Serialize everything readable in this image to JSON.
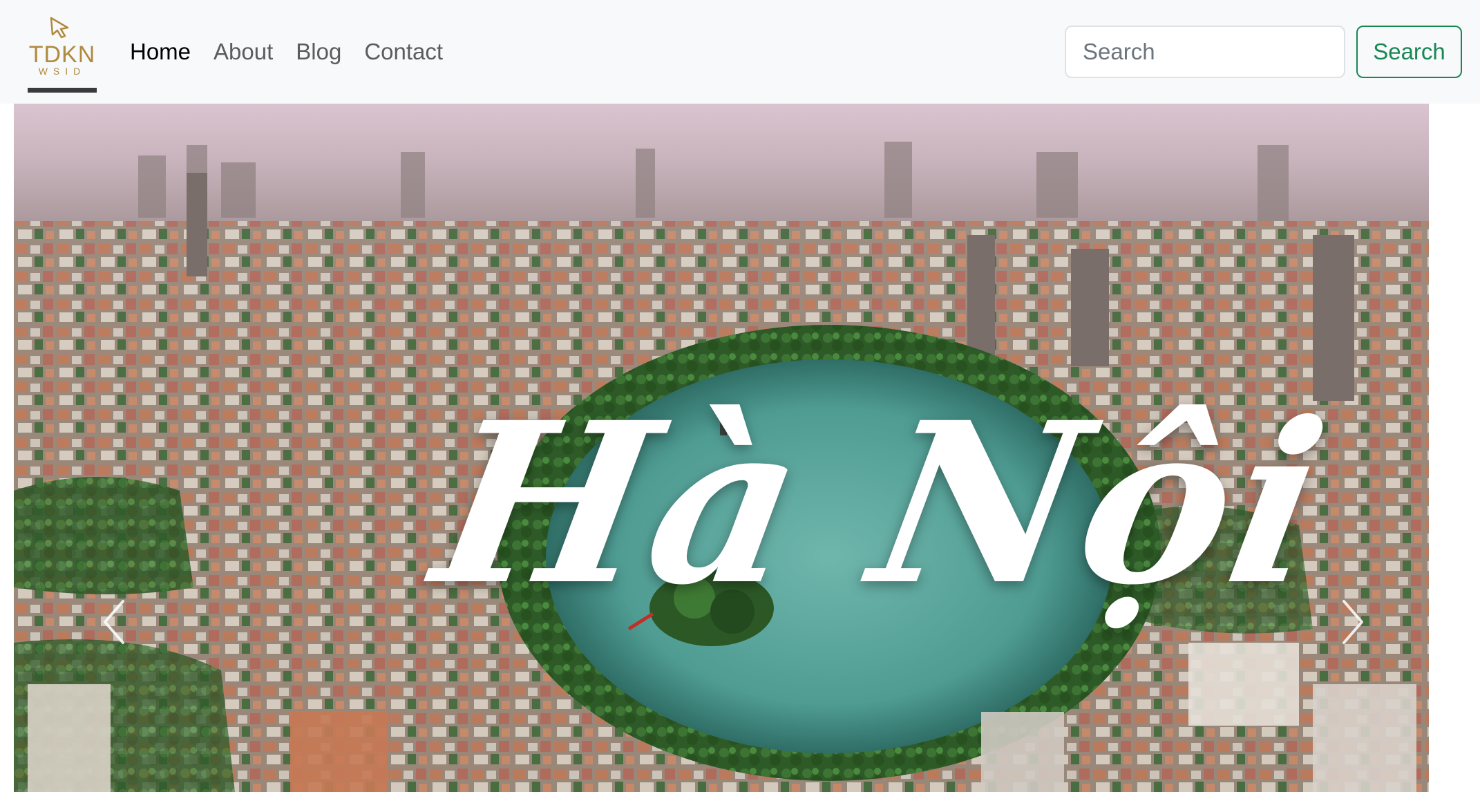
{
  "brand": {
    "logo_text": "TDKN",
    "logo_subtext": "WSID"
  },
  "nav": {
    "items": [
      {
        "label": "Home",
        "active": true
      },
      {
        "label": "About",
        "active": false
      },
      {
        "label": "Blog",
        "active": false
      },
      {
        "label": "Contact",
        "active": false
      }
    ]
  },
  "search": {
    "placeholder": "Search",
    "button_label": "Search"
  },
  "carousel": {
    "caption": "Hà Nội",
    "prev_icon": "chevron-left-icon",
    "next_icon": "chevron-right-icon"
  },
  "colors": {
    "navbar_bg": "#f8f9fa",
    "nav_active": "#000000",
    "nav_inactive": "#5c5c5c",
    "search_button": "#198754",
    "logo_gold": "#b08a3e"
  }
}
